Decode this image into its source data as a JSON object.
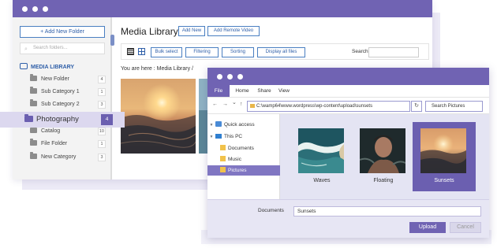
{
  "colors": {
    "brand": "#7063b3",
    "link": "#2f5fa8",
    "selection": "#6b5fb0"
  },
  "media": {
    "sidebar": {
      "new_folder_label": "+ Add New Folder",
      "search_placeholder": "Search folders...",
      "root_label": "MEDIA LIBRARY",
      "items": [
        {
          "label": "New Folder",
          "count": "4"
        },
        {
          "label": "Sub Category 1",
          "count": "1"
        },
        {
          "label": "Sub Category 2",
          "count": "3"
        },
        {
          "label": "Catalog",
          "count": "10"
        },
        {
          "label": "File Folder",
          "count": "1"
        },
        {
          "label": "New Category",
          "count": "3"
        }
      ]
    },
    "title": "Media Library",
    "add_new": "Add New",
    "add_remote": "Add Remote Video",
    "toolbar": {
      "bulk": "Bulk select",
      "filtering": "Filtering",
      "sorting": "Sorting",
      "display_all": "Display all files",
      "search_label": "Search"
    },
    "breadcrumb": "You are here :  Media Library  /"
  },
  "callout": {
    "label": "Photography",
    "count": "4"
  },
  "dialog": {
    "ribbon": [
      "File",
      "Home",
      "Share",
      "View"
    ],
    "nav_back": "←",
    "nav_forward": "→",
    "nav_dropdown": "⌄",
    "nav_up": "↑",
    "address": "C:\\wamp64\\www.wordpress\\wp-content\\upload\\sunsets",
    "refresh_icon": "↻",
    "search_placeholder": "Search Pictures",
    "nav_items": [
      {
        "label": "Quick access"
      },
      {
        "label": "This PC"
      },
      {
        "label": "Documents"
      },
      {
        "label": "Music"
      },
      {
        "label": "Pictures"
      }
    ],
    "tiles": [
      {
        "label": "Waves"
      },
      {
        "label": "Floating"
      },
      {
        "label": "Sunsets"
      }
    ],
    "filename_label": "Documents",
    "filename_value": "Sunsets",
    "upload_label": "Upload",
    "cancel_label": "Cancel"
  }
}
